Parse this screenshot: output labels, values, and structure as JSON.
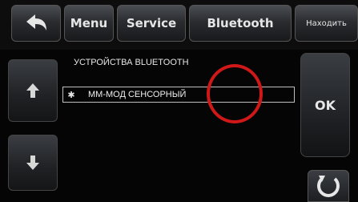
{
  "topbar": {
    "menu_label": "Menu",
    "service_label": "Service",
    "bluetooth_label": "Bluetooth",
    "find_label": "Находить"
  },
  "content": {
    "section_title": "УСТРОЙСТВА BLUETOOTH",
    "devices": [
      {
        "name": "ММ-МОД СЕНСОРНЫЙ",
        "icon": "bluetooth-icon"
      }
    ]
  },
  "right": {
    "ok_label": "OK"
  },
  "icons": {
    "back": "back-arrow-icon",
    "up": "up-arrow-icon",
    "down": "down-arrow-icon",
    "refresh": "refresh-icon"
  },
  "colors": {
    "highlight_ring": "#d01818",
    "button_text": "#e6e6e6"
  }
}
